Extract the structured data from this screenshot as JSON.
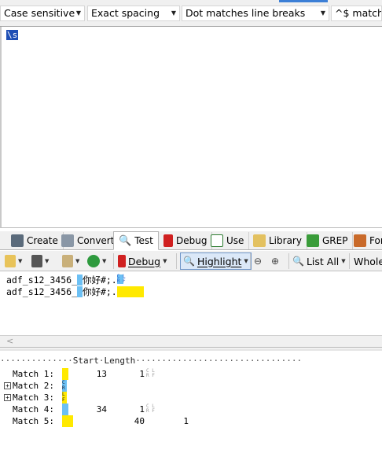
{
  "options": {
    "case": "Case sensitive",
    "spacing": "Exact spacing",
    "dot": "Dot matches line breaks",
    "anchor": "^$ match a"
  },
  "regex": {
    "text": "\\s"
  },
  "tabs": [
    {
      "label": "Create"
    },
    {
      "label": "Convert"
    },
    {
      "label": "Test"
    },
    {
      "label": "Debug"
    },
    {
      "label": "Use"
    },
    {
      "label": "Library"
    },
    {
      "label": "GREP"
    },
    {
      "label": "For"
    }
  ],
  "toolbar": {
    "debug": "Debug",
    "highlight": "Highlight",
    "list_all": "List All",
    "whole": "Whole"
  },
  "subject": {
    "line1_prefix": "adf_s12_3456_",
    "line1_cjk": "你好#;.",
    "line1_marks": "CL\nRF",
    "line2_prefix": "adf_s12_3456_",
    "line2_cjk": "你好#;."
  },
  "results": {
    "header_dots_left": "··············",
    "header_start": "Start",
    "header_sep": "·",
    "header_length": "Length",
    "header_dots_right": "································",
    "rows": [
      {
        "label": "Match 1:",
        "start": "13",
        "length": "1",
        "marks": "CL RF"
      },
      {
        "label": "Match 2:",
        "start": "",
        "length": "",
        "marks": ""
      },
      {
        "label": "Match 3:",
        "start": "",
        "length": "",
        "marks": ""
      },
      {
        "label": "Match 4:",
        "start": "34",
        "length": "1",
        "marks": "CL RF"
      },
      {
        "label": "Match 5:",
        "start": "40",
        "length": "1",
        "marks": ""
      }
    ]
  },
  "colors": {
    "match_blue": "#6cc0f4",
    "match_yellow": "#ffe900",
    "regex_token": "#1f4fb5"
  }
}
